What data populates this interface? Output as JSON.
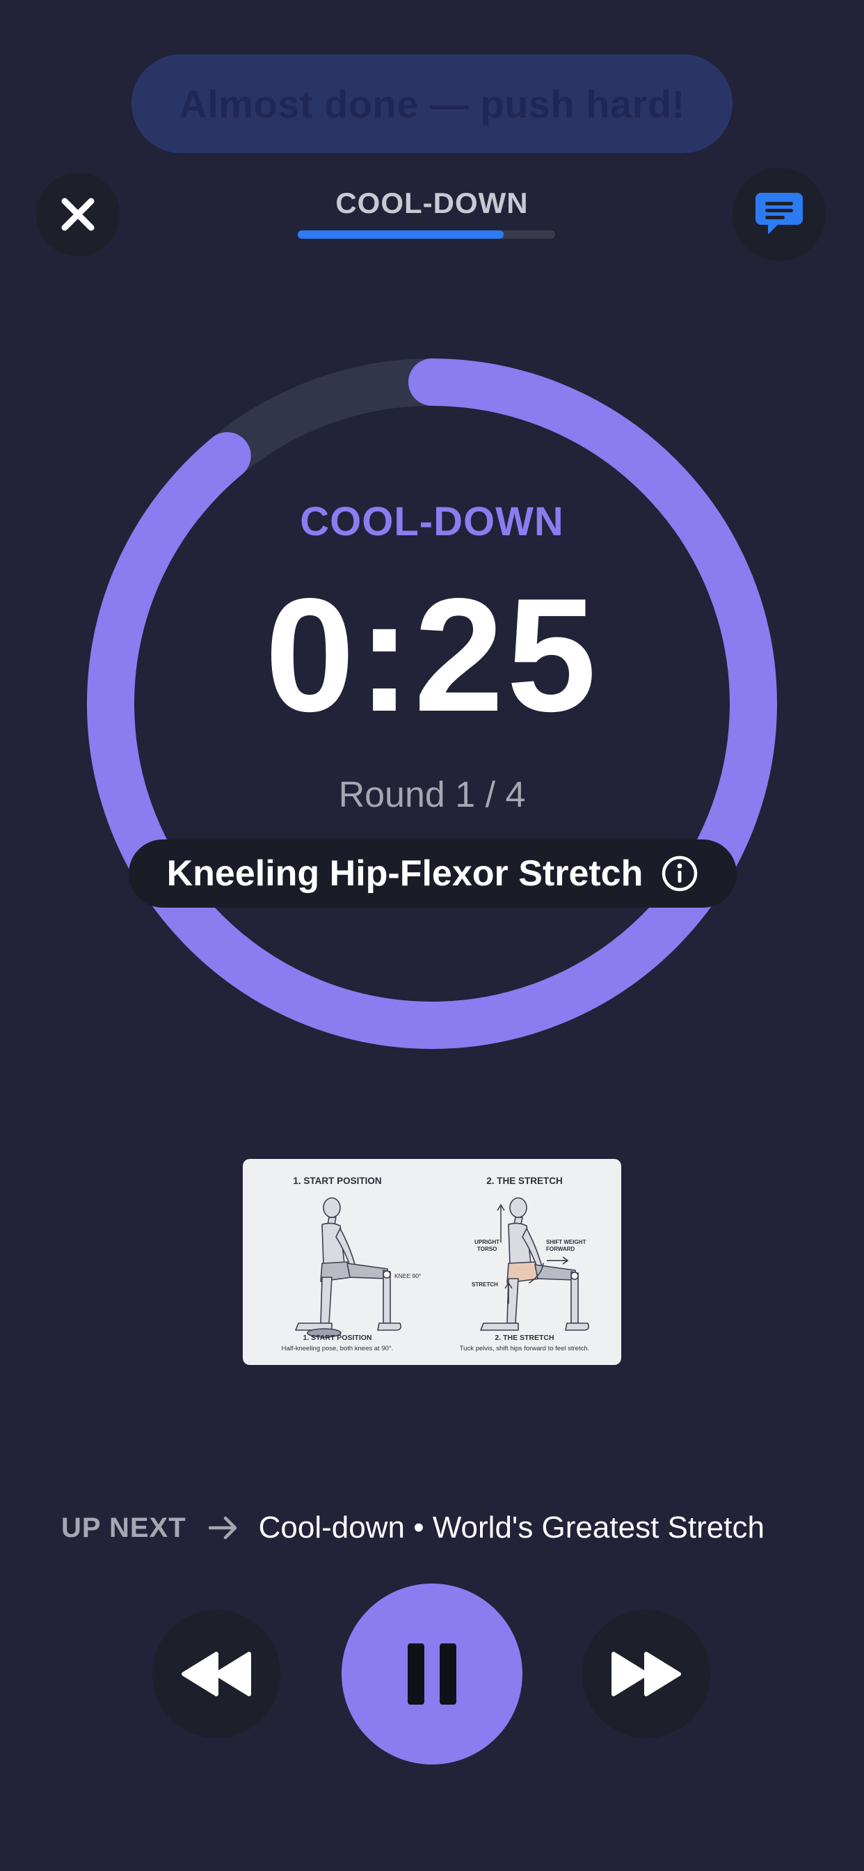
{
  "toast": {
    "text": "Almost done — push hard!"
  },
  "header": {
    "phase_title": "COOL-DOWN",
    "phase_progress": 0.8
  },
  "timer": {
    "phase_label": "COOL-DOWN",
    "time": "0:25",
    "round": "Round 1 / 4",
    "ring_progress": 0.89,
    "exercise_name": "Kneeling Hip-Flexor Stretch"
  },
  "illustration": {
    "left_title": "1. START POSITION",
    "right_title": "2. THE STRETCH",
    "left_caption_title": "1. START POSITION",
    "left_caption": "Half-kneeling pose, both knees at 90°.",
    "right_caption_title": "2. THE STRETCH",
    "right_caption": "Tuck pelvis, shift hips forward to feel stretch.",
    "label_knee": "KNEE 90°",
    "label_upright": "UPRIGHT",
    "label_torso": "TORSO",
    "label_shift": "SHIFT WEIGHT",
    "label_forward": "FORWARD",
    "label_stretch": "STRETCH"
  },
  "up_next": {
    "label": "UP NEXT",
    "text": "Cool-down • World's Greatest Stretch"
  },
  "colors": {
    "background": "#222238",
    "accent": "#8b7cf0",
    "progress_blue": "#2c7bf2",
    "button_dark": "#1d1f2b"
  },
  "icons": {
    "close": "close-icon",
    "chat": "chat-icon",
    "info": "info-icon",
    "rewind": "rewind-icon",
    "pause": "pause-icon",
    "forward": "fast-forward-icon",
    "arrow": "arrow-right-icon"
  }
}
